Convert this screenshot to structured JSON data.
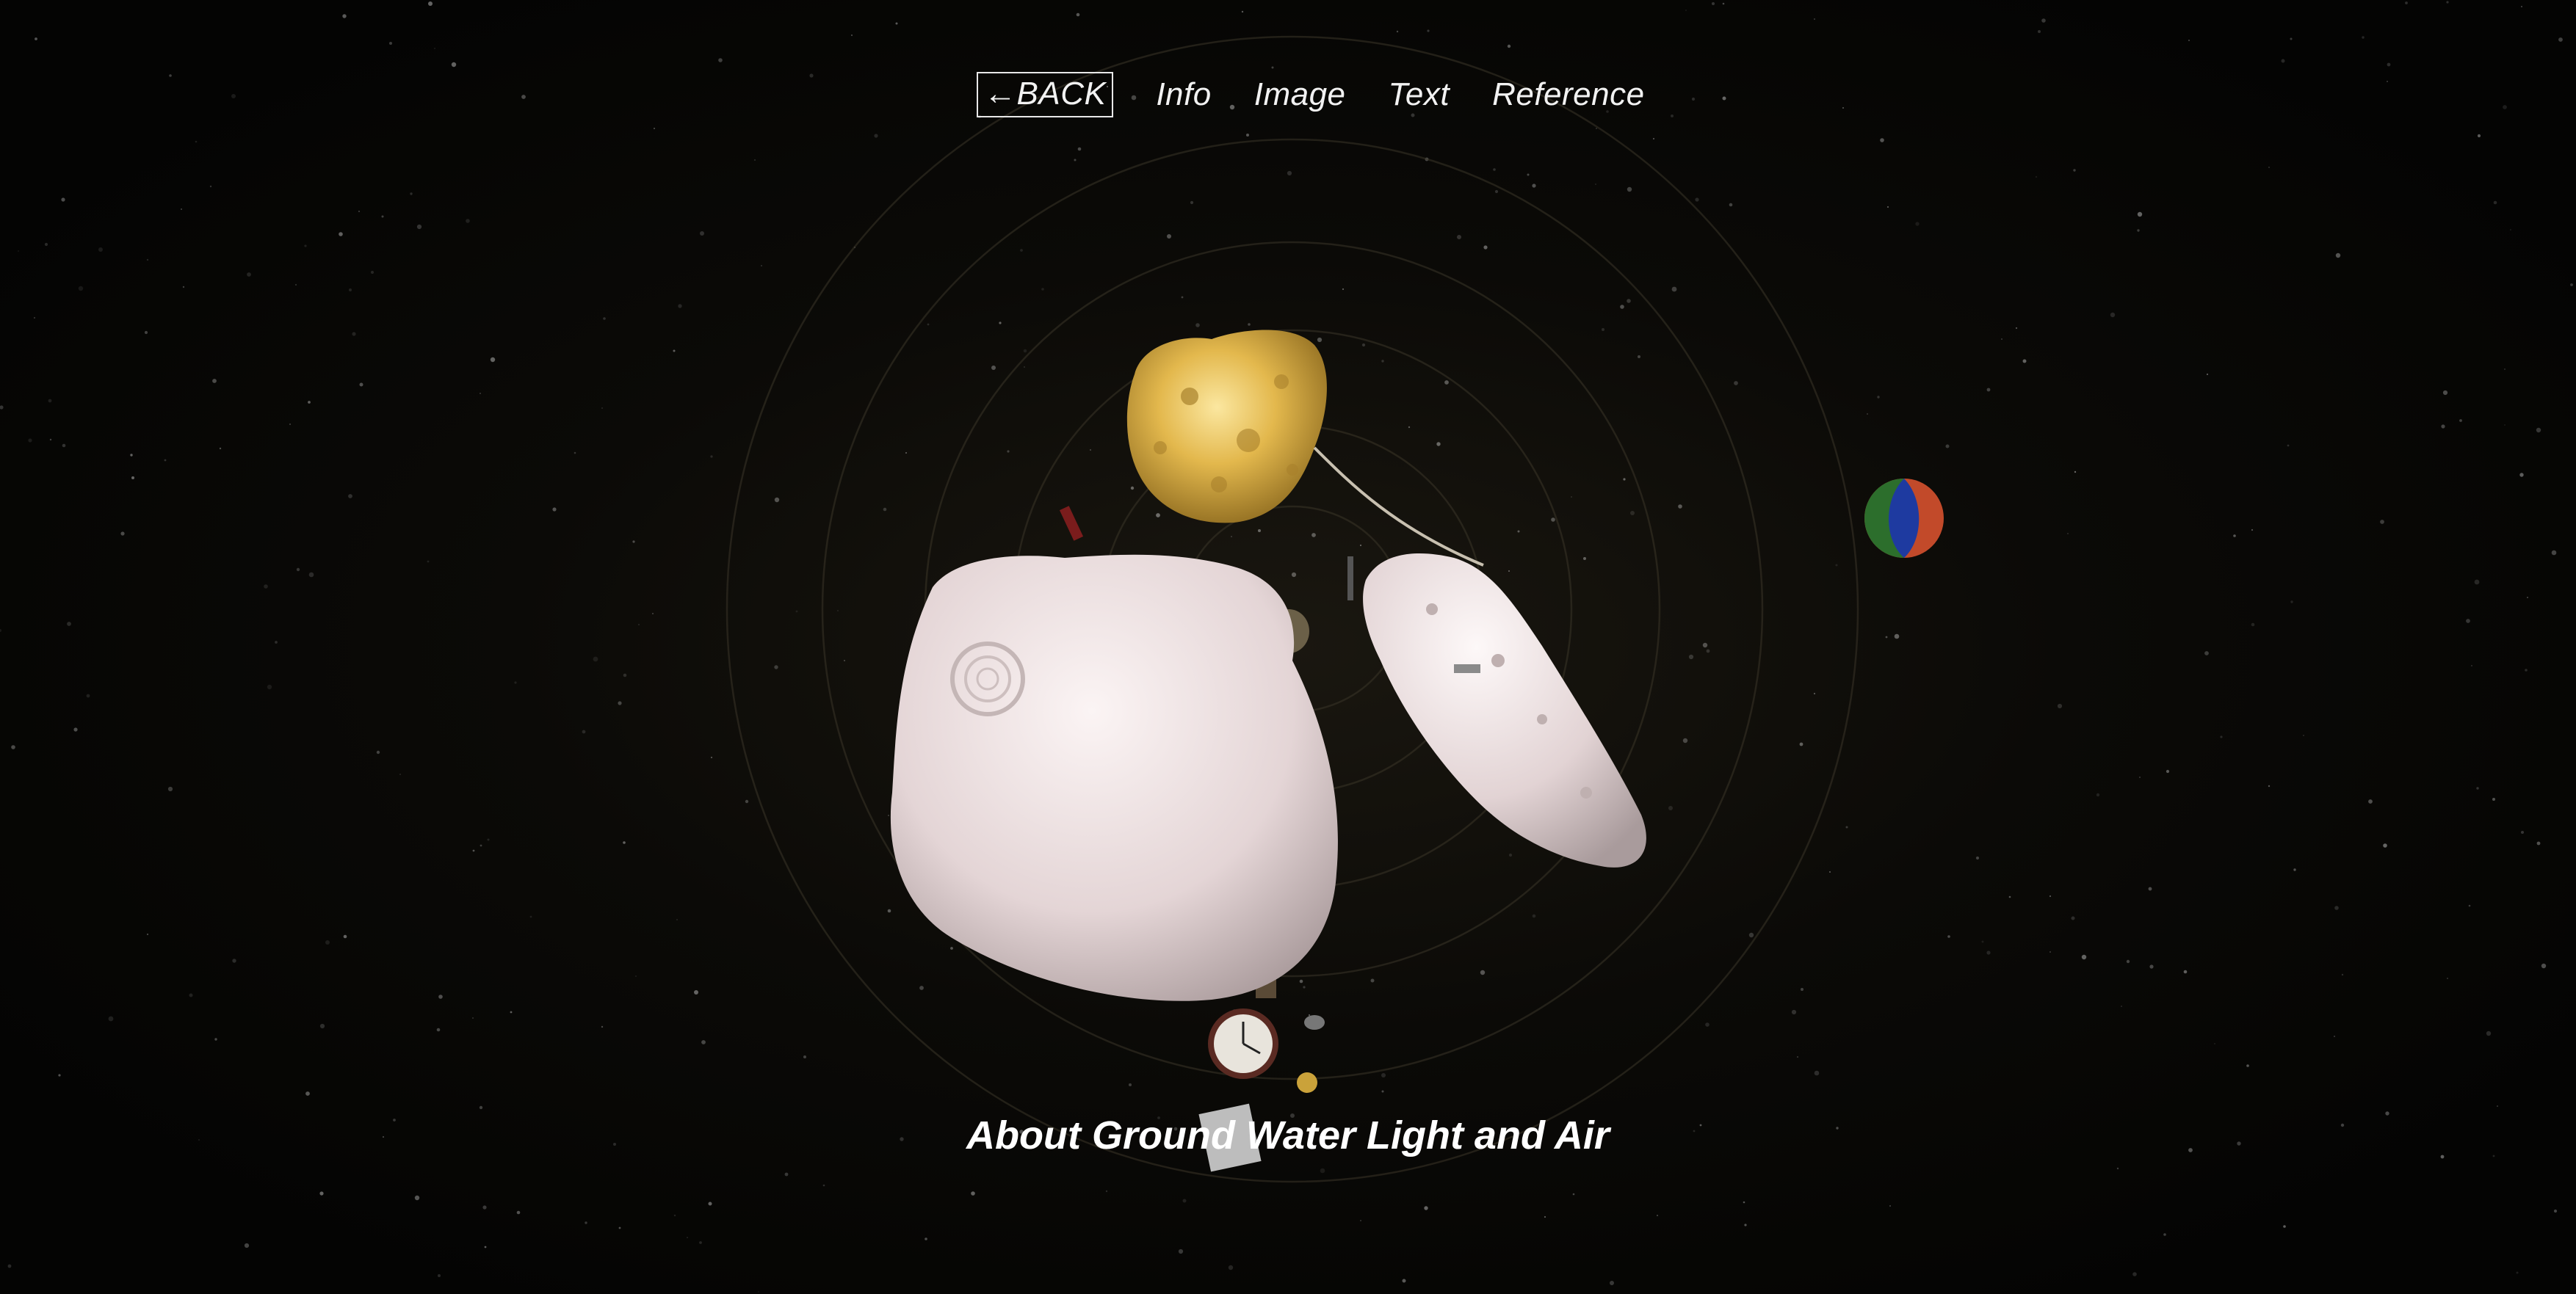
{
  "nav": {
    "back_label": "←BACK",
    "info_label": "Info",
    "image_label": "Image",
    "text_label": "Text",
    "reference_label": "Reference"
  },
  "caption": "About Ground Water Light and Air",
  "colors": {
    "background": "#050403",
    "text": "#ffffff",
    "gold_asteroid": "#d8b24a",
    "white_asteroid": "#e9dcdc"
  }
}
